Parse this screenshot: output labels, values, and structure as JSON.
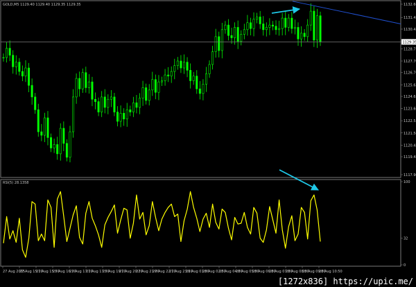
{
  "header": {
    "symbol_line": "GOLD,M5  1129.40 1129.40 1129.35 1129.35",
    "indicator_label": "RSI(5) 28.1358"
  },
  "colors": {
    "background": "#000000",
    "candles": "#00ff00",
    "rsi_line": "#ffff00",
    "arrow": "#1fc7e6",
    "trendline": "#2050d0",
    "horizontal_line": "#7a7a7a",
    "grid_border": "#7a7a7a",
    "current_price_box": "#ffffff"
  },
  "chart_data": [
    {
      "type": "line",
      "name": "price",
      "ylim": [
        1117.9,
        1132.6
      ],
      "y_ticks": [
        1132.6,
        1131.45,
        1130.45,
        1129.35,
        1128.75,
        1127.7,
        1126.7,
        1125.65,
        1124.65,
        1123.6,
        1122.55,
        1121.5,
        1120.45,
        1119.45,
        1117.9
      ],
      "current_price": "1129.35",
      "x_ticks": [
        "27 Aug 2015",
        "27 Aug 15:10",
        "27 Aug 15:50",
        "27 Aug 16:30",
        "27 Aug 17:10",
        "27 Aug 17:50",
        "27 Aug 19:10",
        "27 Aug 20:20",
        "27 Aug 21:00",
        "27 Aug 22:10",
        "27 Aug 23:10",
        "28 Aug 01:00",
        "28 Aug 02:50",
        "28 Aug 04:00",
        "28 Aug 05:00",
        "28 Aug 06:00",
        "28 Aug 07:00",
        "28 Aug 08:00",
        "28 Aug 09:00",
        "28 Aug 10:50"
      ],
      "values": [
        1128.0,
        1128.8,
        1128.2,
        1127.2,
        1127.6,
        1126.8,
        1126.4,
        1127.1,
        1125.6,
        1124.6,
        1123.5,
        1121.6,
        1121.3,
        1122.8,
        1121.1,
        1120.2,
        1120.5,
        1119.7,
        1121.9,
        1120.6,
        1119.4,
        1121.6,
        1124.6,
        1126.2,
        1125.3,
        1126.7,
        1125.4,
        1125.9,
        1124.4,
        1124.2,
        1123.3,
        1124.6,
        1123.7,
        1124.4,
        1124.6,
        1123.3,
        1122.5,
        1123.2,
        1122.7,
        1123.5,
        1123.3,
        1124.1,
        1123.7,
        1124.5,
        1125.4,
        1124.3,
        1125.2,
        1126.1,
        1125.0,
        1125.9,
        1126.0,
        1126.5,
        1126.4,
        1126.8,
        1127.3,
        1127.7,
        1127.1,
        1127.6,
        1126.9,
        1126.0,
        1126.4,
        1125.3,
        1124.9,
        1125.7,
        1126.6,
        1127.4,
        1128.5,
        1129.8,
        1128.6,
        1130.4,
        1130.8,
        1129.9,
        1129.7,
        1130.6,
        1129.4,
        1130.0,
        1130.4,
        1131.0,
        1130.5,
        1131.3,
        1131.5,
        1130.9,
        1130.4,
        1130.6,
        1130.8,
        1130.7,
        1130.4,
        1130.5,
        1131.4,
        1130.6,
        1131.4,
        1130.5,
        1130.6,
        1129.6,
        1130.1,
        1129.8,
        1130.8,
        1132.0,
        1129.5,
        1131.6,
        1129.35
      ],
      "annotations": [
        "upward arrow above recent highs",
        "descending trendline from top-right"
      ]
    },
    {
      "type": "line",
      "name": "RSI(5)",
      "ylim": [
        0,
        100
      ],
      "y_ticks": [
        100,
        32,
        0
      ],
      "values": [
        26,
        58,
        31,
        41,
        27,
        56,
        18,
        9,
        32,
        76,
        73,
        29,
        37,
        29,
        78,
        69,
        21,
        79,
        88,
        59,
        28,
        44,
        60,
        71,
        33,
        25,
        62,
        76,
        56,
        47,
        36,
        21,
        48,
        57,
        64,
        72,
        38,
        54,
        68,
        66,
        32,
        50,
        84,
        55,
        63,
        36,
        47,
        76,
        57,
        41,
        55,
        63,
        69,
        73,
        58,
        61,
        28,
        53,
        67,
        88,
        69,
        56,
        40,
        55,
        62,
        45,
        73,
        51,
        43,
        67,
        63,
        44,
        30,
        57,
        49,
        50,
        63,
        45,
        37,
        69,
        62,
        32,
        27,
        42,
        70,
        54,
        38,
        78,
        42,
        20,
        46,
        59,
        29,
        37,
        69,
        63,
        31,
        77,
        84,
        66,
        28
      ]
    }
  ],
  "watermark": "[1272x836] https://upic.me/"
}
